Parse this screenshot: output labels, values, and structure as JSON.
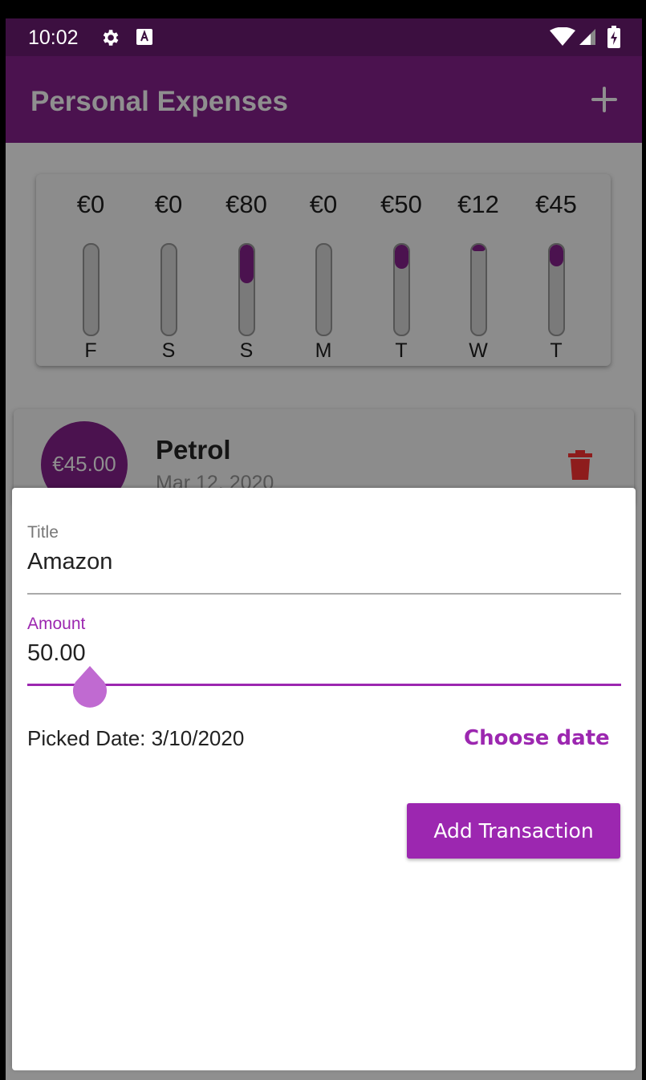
{
  "status_bar": {
    "time": "10:02",
    "icons": [
      "gear-icon",
      "a-notification-icon",
      "wifi-icon",
      "signal-icon",
      "battery-charging-icon"
    ]
  },
  "app_bar": {
    "title": "Personal Expenses",
    "add_icon": "plus-icon"
  },
  "chart": {
    "bars": [
      {
        "amount": "€0",
        "day": "F",
        "value": 0
      },
      {
        "amount": "€0",
        "day": "S",
        "value": 0
      },
      {
        "amount": "€80",
        "day": "S",
        "value": 80
      },
      {
        "amount": "€0",
        "day": "M",
        "value": 0
      },
      {
        "amount": "€50",
        "day": "T",
        "value": 50
      },
      {
        "amount": "€12",
        "day": "W",
        "value": 12
      },
      {
        "amount": "€45",
        "day": "T",
        "value": 45
      }
    ],
    "fill_fractions": [
      0,
      0,
      0.43,
      0,
      0.27,
      0.07,
      0.24
    ],
    "colors": {
      "fill": "#4b124f",
      "track": "#7a7a7a"
    }
  },
  "transaction": {
    "amount": "€45.00",
    "title": "Petrol",
    "date": "Mar 12, 2020",
    "delete_icon": "trash-icon"
  },
  "form": {
    "title_label": "Title",
    "title_value": "Amazon",
    "amount_label": "Amount",
    "amount_value": "50.00",
    "picked_date": "Picked Date: 3/10/2020",
    "choose_date_label": "Choose date",
    "submit_label": "Add Transaction"
  },
  "colors": {
    "primary": "#9c27b0",
    "primary_dark": "#4b124f",
    "delete": "#c62828"
  }
}
